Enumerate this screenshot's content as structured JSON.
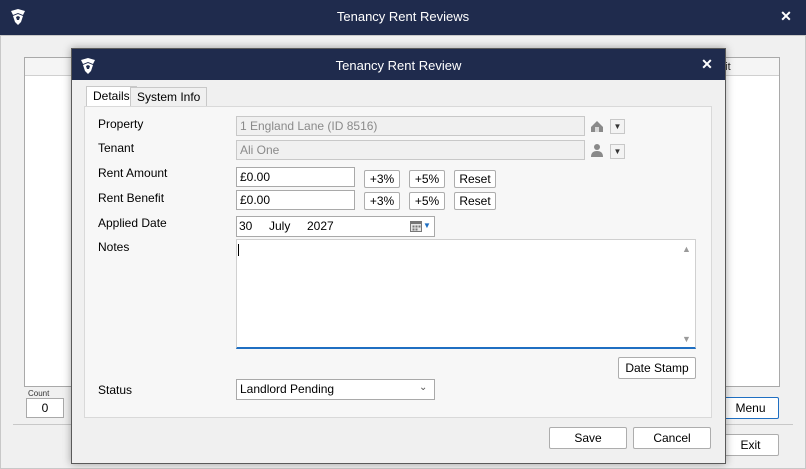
{
  "back_window": {
    "title": "Tenancy Rent Reviews",
    "grid_header_partial": "efit",
    "count_label": "Count",
    "count_value": "0",
    "menu_label": "Menu",
    "exit_label": "Exit",
    "close_glyph": "✕"
  },
  "dialog": {
    "title": "Tenancy Rent Review",
    "close_glyph": "✕",
    "tabs": [
      {
        "label": "Details",
        "active": true
      },
      {
        "label": "System Info",
        "active": false
      }
    ],
    "fields": {
      "property": {
        "label": "Property",
        "value": "1 England Lane (ID 8516)",
        "icon": "building-icon"
      },
      "tenant": {
        "label": "Tenant",
        "value": "Ali One",
        "icon": "person-icon"
      },
      "rent_amount": {
        "label": "Rent Amount",
        "value": "£0.00"
      },
      "rent_benefit": {
        "label": "Rent Benefit",
        "value": "£0.00"
      },
      "applied_date": {
        "label": "Applied Date",
        "day": "30",
        "month": "July",
        "year": "2027",
        "icon": "calendar-icon"
      },
      "notes": {
        "label": "Notes",
        "value": ""
      },
      "status": {
        "label": "Status",
        "value": "Landlord Pending"
      }
    },
    "buttons": {
      "plus3": "+3%",
      "plus5": "+5%",
      "reset": "Reset",
      "date_stamp": "Date Stamp",
      "save": "Save",
      "cancel": "Cancel"
    }
  },
  "colors": {
    "titlebar": "#1f2b4d",
    "focus_accent": "#1f6fc2"
  }
}
